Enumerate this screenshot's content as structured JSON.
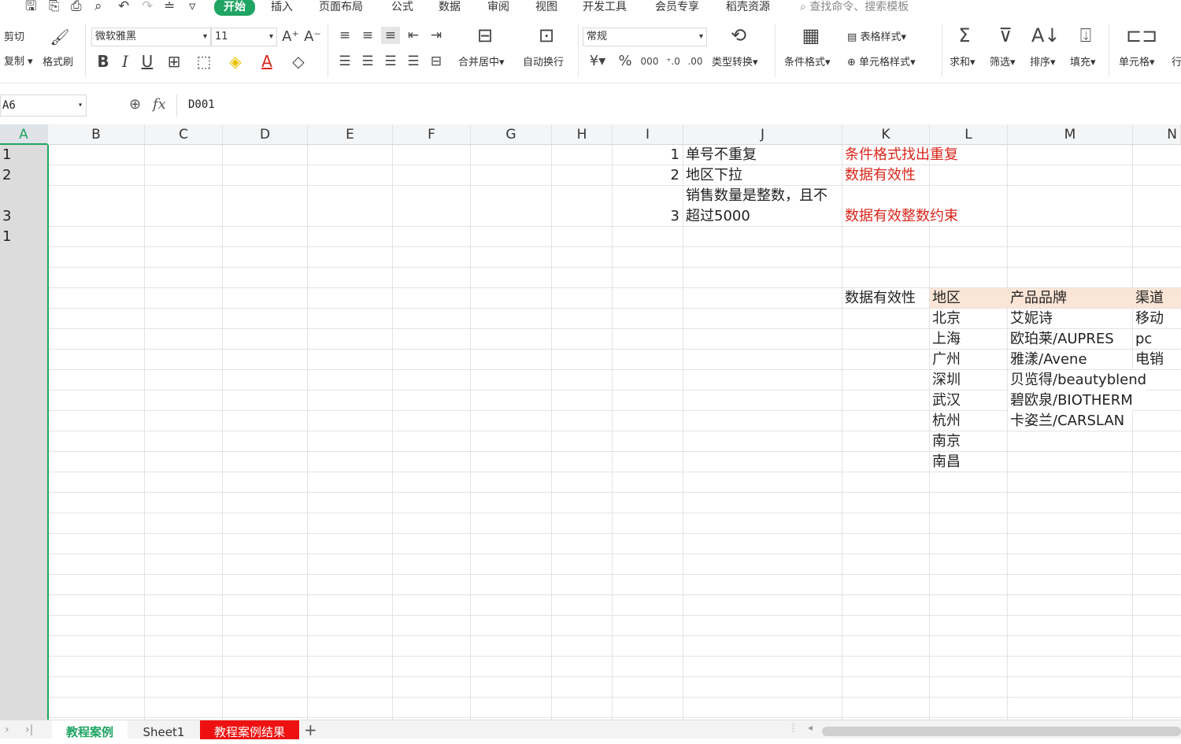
{
  "menu": {
    "tabs": [
      "开始",
      "插入",
      "页面布局",
      "公式",
      "数据",
      "审阅",
      "视图",
      "开发工具",
      "会员专享",
      "稻壳资源"
    ],
    "search_placeholder": "查找命令、搜索模板"
  },
  "ribbon": {
    "cut": "剪切",
    "copy": "复制",
    "format_painter": "格式刷",
    "font_name": "微软雅黑",
    "font_size": "11",
    "merge_center": "合并居中",
    "auto_wrap": "自动换行",
    "number_format": "常规",
    "type_convert": "类型转换",
    "conditional_format": "条件格式",
    "table_style": "表格样式",
    "cell_style": "单元格样式",
    "sum": "求和",
    "filter": "筛选",
    "sort": "排序",
    "fill": "填充",
    "cell": "单元格",
    "row_col": "行"
  },
  "formula_bar": {
    "name_box": "A6",
    "fx": "fx",
    "value": "D001"
  },
  "columns": [
    "A",
    "B",
    "C",
    "D",
    "E",
    "F",
    "G",
    "H",
    "I",
    "J",
    "K",
    "L",
    "M",
    "N"
  ],
  "row_numbers": [
    "1",
    "2",
    "3",
    "1"
  ],
  "notes": [
    {
      "num": "1",
      "text": "单号不重复",
      "tip": "条件格式找出重复"
    },
    {
      "num": "2",
      "text": "地区下拉",
      "tip": "数据有效性"
    },
    {
      "num": "3",
      "text_line1": "销售数量是整数，且不",
      "text_line2": "超过5000",
      "tip": "数据有效整数约束"
    }
  ],
  "validation": {
    "label": "数据有效性",
    "headers": [
      "地区",
      "产品品牌",
      "渠道"
    ],
    "regions": [
      "北京",
      "上海",
      "广州",
      "深圳",
      "武汉",
      "杭州",
      "南京",
      "南昌"
    ],
    "brands": [
      "艾妮诗",
      "欧珀莱/AUPRES",
      "雅漾/Avene",
      "贝览得/beautyblend",
      "碧欧泉/BIOTHERM",
      "卡姿兰/CARSLAN"
    ],
    "channels": [
      "移动",
      "pc",
      "电销"
    ]
  },
  "sheets": [
    "教程案例",
    "Sheet1",
    "教程案例结果"
  ],
  "colors": {
    "accent": "#1fa463",
    "tip_red": "#d9261c",
    "header_fill": "#fbe5d6",
    "red_tab": "#ee1111"
  }
}
